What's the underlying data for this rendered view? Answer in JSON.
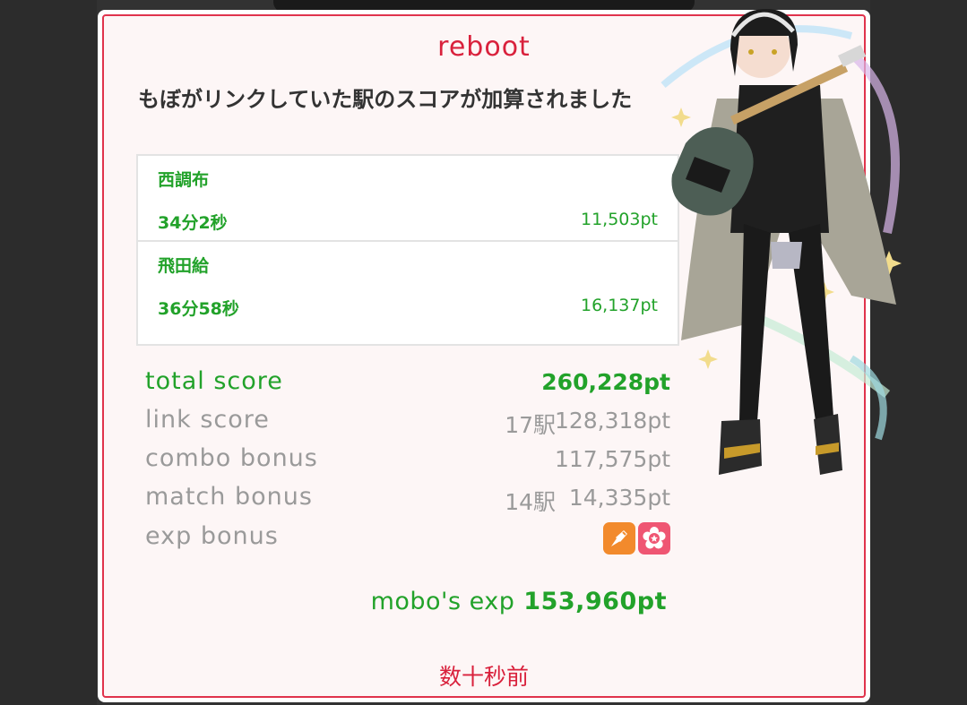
{
  "dialog": {
    "title": "reboot",
    "message": "もぼがリンクしていた駅のスコアが加算されました",
    "time_ago": "数十秒前"
  },
  "stations": [
    {
      "name": "西調布",
      "time": "34分2秒",
      "score": "11,503pt"
    },
    {
      "name": "飛田給",
      "time": "36分58秒",
      "score": "16,137pt"
    }
  ],
  "scores": {
    "total": {
      "label": "total score",
      "value": "260,228pt"
    },
    "link": {
      "label": "link score",
      "count": "17駅",
      "value": "128,318pt"
    },
    "combo": {
      "label": "combo bonus",
      "value": "117,575pt"
    },
    "match": {
      "label": "match bonus",
      "count": "14駅",
      "value": "14,335pt"
    },
    "exp": {
      "label": "exp bonus",
      "badges": [
        "orange-rocket-icon",
        "pink-flower-icon"
      ]
    }
  },
  "exp_result": {
    "label": "mobo's exp",
    "value": "153,960pt"
  },
  "colors": {
    "accent_red": "#d9213c",
    "accent_green": "#22a22a",
    "muted_gray": "#9a9a9a",
    "badge_orange": "#f28a2c",
    "badge_pink": "#ef5673"
  }
}
